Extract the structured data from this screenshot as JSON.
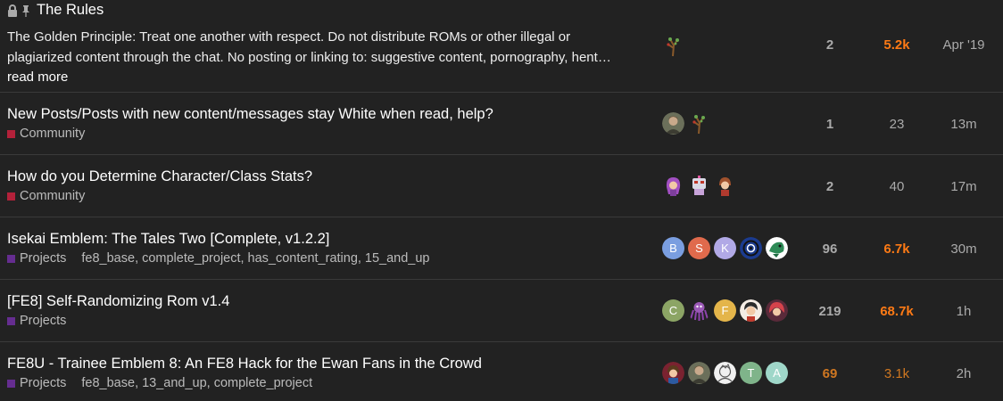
{
  "topics": [
    {
      "title": "The Rules",
      "excerpt": "The Golden Principle: Treat one another with respect. Do not distribute ROMs or other illegal or plagiarized content through the chat. No posting or linking to: suggestive content, pornography, hent…",
      "read_more": "read more",
      "replies": "2",
      "views": "5.2k",
      "activity": "Apr '19"
    },
    {
      "title": "New Posts/Posts with new content/messages stay White when read, help?",
      "category": "Community",
      "replies": "1",
      "views": "23",
      "activity": "13m"
    },
    {
      "title": "How do you Determine Character/Class Stats?",
      "category": "Community",
      "replies": "2",
      "views": "40",
      "activity": "17m"
    },
    {
      "title": "Isekai Emblem: The Tales Two [Complete, v1.2.2]",
      "category": "Projects",
      "tags": [
        "fe8_base",
        "complete_project",
        "has_content_rating",
        "15_and_up"
      ],
      "avatars": [
        "B",
        "S",
        "K"
      ],
      "replies": "96",
      "views": "6.7k",
      "activity": "30m"
    },
    {
      "title": "[FE8] Self-Randomizing Rom v1.4",
      "category": "Projects",
      "avatars": [
        "C",
        "F"
      ],
      "replies": "219",
      "views": "68.7k",
      "activity": "1h"
    },
    {
      "title": "FE8U - Trainee Emblem 8: An FE8 Hack for the Ewan Fans in the Crowd",
      "category": "Projects",
      "tags": [
        "fe8_base",
        "13_and_up",
        "complete_project"
      ],
      "avatars": [
        "T",
        "A"
      ],
      "replies": "69",
      "views": "3.1k",
      "activity": "2h"
    }
  ],
  "colors": {
    "community": "#b3213a",
    "projects": "#652d90",
    "views_hot": "#fe7a15",
    "views_warm": "#cf7721",
    "avatar_b": "#7a9ee0",
    "avatar_s": "#e06a4c",
    "avatar_k": "#b1a9e6",
    "avatar_c": "#8ca565",
    "avatar_f": "#e4b54a",
    "avatar_t": "#7fb48a",
    "avatar_a": "#9fd7c9"
  },
  "icons": [
    "lock-icon",
    "pin-icon"
  ]
}
